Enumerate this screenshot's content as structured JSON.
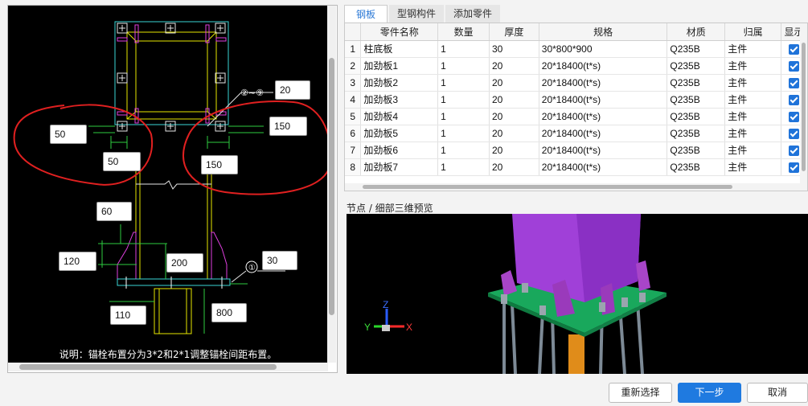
{
  "drawing": {
    "dimensions": [
      {
        "name": "dim-input-20",
        "value": "20"
      },
      {
        "name": "dim-input-50-a",
        "value": "50"
      },
      {
        "name": "dim-input-150-a",
        "value": "150"
      },
      {
        "name": "dim-input-50-b",
        "value": "50"
      },
      {
        "name": "dim-input-150-b",
        "value": "150"
      },
      {
        "name": "dim-input-60",
        "value": "60"
      },
      {
        "name": "dim-input-120",
        "value": "120"
      },
      {
        "name": "dim-input-200",
        "value": "200"
      },
      {
        "name": "dim-input-30",
        "value": "30"
      },
      {
        "name": "dim-input-110",
        "value": "110"
      },
      {
        "name": "dim-input-800",
        "value": "800"
      }
    ],
    "callout_stiffener": "②~⑨",
    "callout_base": "①",
    "note": "说明：锚栓布置分为3*2和2*1调整锚栓间距布置。"
  },
  "tabs": [
    {
      "label": "钢板",
      "active": true
    },
    {
      "label": "型钢构件",
      "active": false
    },
    {
      "label": "添加零件",
      "active": false
    }
  ],
  "table": {
    "columns": [
      "",
      "零件名称",
      "数量",
      "厚度",
      "规格",
      "材质",
      "归属",
      "显示"
    ],
    "rows": [
      {
        "idx": "1",
        "name": "柱底板",
        "qty": "1",
        "thick": "30",
        "spec": "30*800*900",
        "mat": "Q235B",
        "owner": "主件"
      },
      {
        "idx": "2",
        "name": "加劲板1",
        "qty": "1",
        "thick": "20",
        "spec": "20*18400(t*s)",
        "mat": "Q235B",
        "owner": "主件"
      },
      {
        "idx": "3",
        "name": "加劲板2",
        "qty": "1",
        "thick": "20",
        "spec": "20*18400(t*s)",
        "mat": "Q235B",
        "owner": "主件"
      },
      {
        "idx": "4",
        "name": "加劲板3",
        "qty": "1",
        "thick": "20",
        "spec": "20*18400(t*s)",
        "mat": "Q235B",
        "owner": "主件"
      },
      {
        "idx": "5",
        "name": "加劲板4",
        "qty": "1",
        "thick": "20",
        "spec": "20*18400(t*s)",
        "mat": "Q235B",
        "owner": "主件"
      },
      {
        "idx": "6",
        "name": "加劲板5",
        "qty": "1",
        "thick": "20",
        "spec": "20*18400(t*s)",
        "mat": "Q235B",
        "owner": "主件"
      },
      {
        "idx": "7",
        "name": "加劲板6",
        "qty": "1",
        "thick": "20",
        "spec": "20*18400(t*s)",
        "mat": "Q235B",
        "owner": "主件"
      },
      {
        "idx": "8",
        "name": "加劲板7",
        "qty": "1",
        "thick": "20",
        "spec": "20*18400(t*s)",
        "mat": "Q235B",
        "owner": "主件"
      }
    ]
  },
  "preview": {
    "label": "节点 / 细部三维预览",
    "axis_x": "X",
    "axis_y": "Y",
    "axis_z": "Z"
  },
  "buttons": {
    "reselect": "重新选择",
    "next": "下一步",
    "cancel": "取消"
  },
  "colors": {
    "accent": "#1f7ae0",
    "annotation_red": "#e02020",
    "dimension_green": "#2ecc40",
    "steel_purple": "#9b3fd1",
    "plate_green": "#1fb86a"
  }
}
